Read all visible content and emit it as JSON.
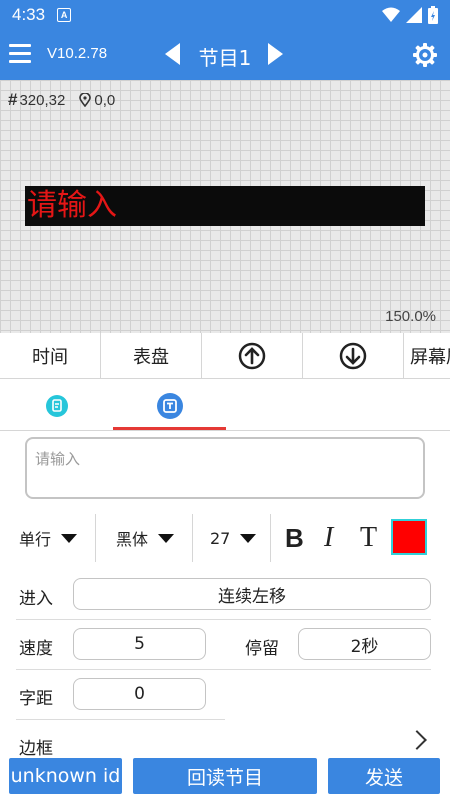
{
  "status_bar": {
    "time": "4:33",
    "notification_icon": "a-app-icon"
  },
  "app_bar": {
    "version": "V10.2.78",
    "program_title": "节目1"
  },
  "canvas": {
    "size_readout": "320,32",
    "position_readout": "0,0",
    "led_text": "请输入",
    "zoom": "150.0%"
  },
  "toolbar": {
    "time": "时间",
    "dial": "表盘",
    "up_icon": "arrow-up-circle-icon",
    "down_icon": "arrow-down-circle-icon",
    "screen": "屏幕属性"
  },
  "tabs": [
    {
      "icon": "document-icon"
    },
    {
      "icon": "text-icon"
    }
  ],
  "text_input": {
    "placeholder": "请输入"
  },
  "style": {
    "line_mode": "单行",
    "font": "黑体",
    "font_size": "27",
    "bold": "B",
    "italic": "I",
    "text_style": "T",
    "color": "#ff0000"
  },
  "form": {
    "enter_label": "进入",
    "enter_value": "连续左移",
    "speed_label": "速度",
    "speed_value": "5",
    "stay_label": "停留",
    "stay_value": "2秒",
    "spacing_label": "字距",
    "spacing_value": "0",
    "border_label": "边框"
  },
  "bottom_bar": {
    "device_id": "unknown id",
    "read_back": "回读节目",
    "send": "发送"
  },
  "colors": {
    "primary": "#3a86e0",
    "led_background": "#0b0b0b",
    "led_text": "#e41616",
    "tab_indicator": "#e53935"
  }
}
